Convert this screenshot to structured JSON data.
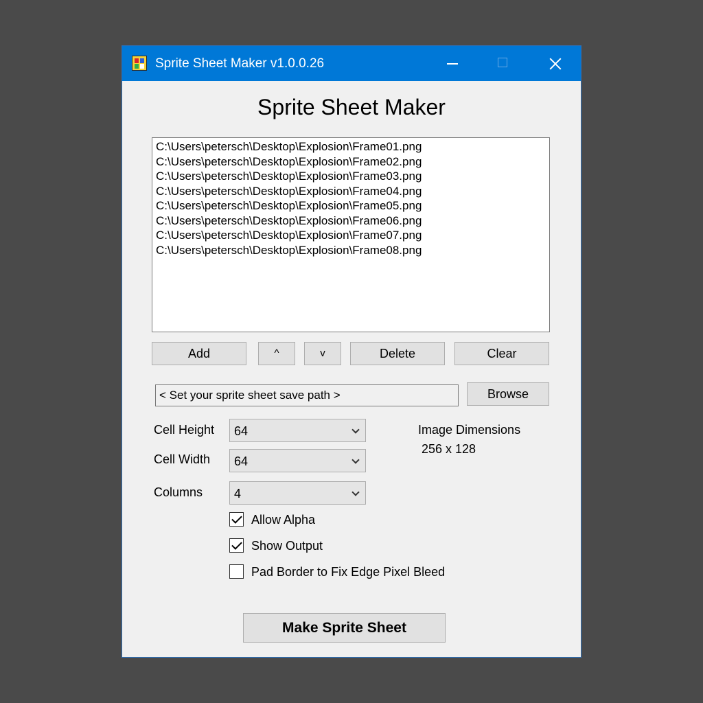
{
  "window": {
    "title": "Sprite Sheet Maker v1.0.0.26",
    "app_heading": "Sprite Sheet Maker"
  },
  "file_list": {
    "items": [
      "C:\\Users\\petersch\\Desktop\\Explosion\\Frame01.png",
      "C:\\Users\\petersch\\Desktop\\Explosion\\Frame02.png",
      "C:\\Users\\petersch\\Desktop\\Explosion\\Frame03.png",
      "C:\\Users\\petersch\\Desktop\\Explosion\\Frame04.png",
      "C:\\Users\\petersch\\Desktop\\Explosion\\Frame05.png",
      "C:\\Users\\petersch\\Desktop\\Explosion\\Frame06.png",
      "C:\\Users\\petersch\\Desktop\\Explosion\\Frame07.png",
      "C:\\Users\\petersch\\Desktop\\Explosion\\Frame08.png"
    ]
  },
  "list_buttons": {
    "add": "Add",
    "up": "^",
    "down": "v",
    "delete": "Delete",
    "clear": "Clear"
  },
  "save_path": {
    "value": "< Set your sprite sheet save path >",
    "browse": "Browse"
  },
  "settings": {
    "cell_height_label": "Cell Height",
    "cell_height_value": "64",
    "cell_width_label": "Cell Width",
    "cell_width_value": "64",
    "columns_label": "Columns",
    "columns_value": "4",
    "image_dimensions_label": "Image Dimensions",
    "image_dimensions_value": "256 x 128"
  },
  "options": {
    "allow_alpha": {
      "label": "Allow Alpha",
      "checked": true
    },
    "show_output": {
      "label": "Show Output",
      "checked": true
    },
    "pad_border": {
      "label": "Pad Border to Fix Edge Pixel Bleed",
      "checked": false
    }
  },
  "actions": {
    "make": "Make Sprite Sheet"
  },
  "colors": {
    "titlebar": "#0078d7",
    "window_bg": "#f0f0f0",
    "desktop_bg": "#4a4a4a"
  },
  "icons": {
    "app": "app-icon",
    "minimize": "minimize-icon",
    "maximize": "maximize-icon",
    "close": "close-icon",
    "dropdown": "chevron-down-icon",
    "check": "checkmark-icon"
  }
}
